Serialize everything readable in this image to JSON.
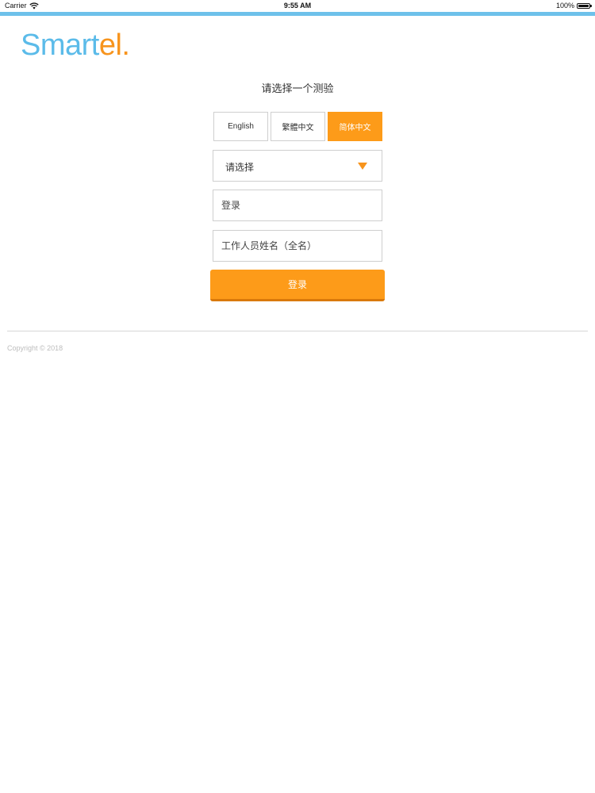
{
  "status_bar": {
    "carrier": "Carrier",
    "wifi_icon": "wifi-icon",
    "time": "9:55 AM",
    "battery_percent": "100%",
    "battery_icon": "battery-full-icon"
  },
  "logo": {
    "part1": "Smart",
    "part2": "el.",
    "color1": "#5bbbe9",
    "color2": "#f7941d"
  },
  "heading": "请选择一个测验",
  "language_tabs": [
    {
      "label": "English",
      "active": false
    },
    {
      "label": "繁體中文",
      "active": false
    },
    {
      "label": "简体中文",
      "active": true
    }
  ],
  "test_select": {
    "value": "请选择",
    "icon": "dropdown-arrow-icon"
  },
  "login_field": {
    "placeholder": "登录",
    "value": ""
  },
  "staff_name_field": {
    "placeholder": "工作人员姓名（全名）",
    "value": ""
  },
  "login_button": {
    "label": "登录"
  },
  "footer": {
    "copyright": "Copyright © 2018"
  },
  "colors": {
    "accent": "#fd9b19",
    "top_bar": "#6ec1ea",
    "border": "#cfcfcf"
  }
}
